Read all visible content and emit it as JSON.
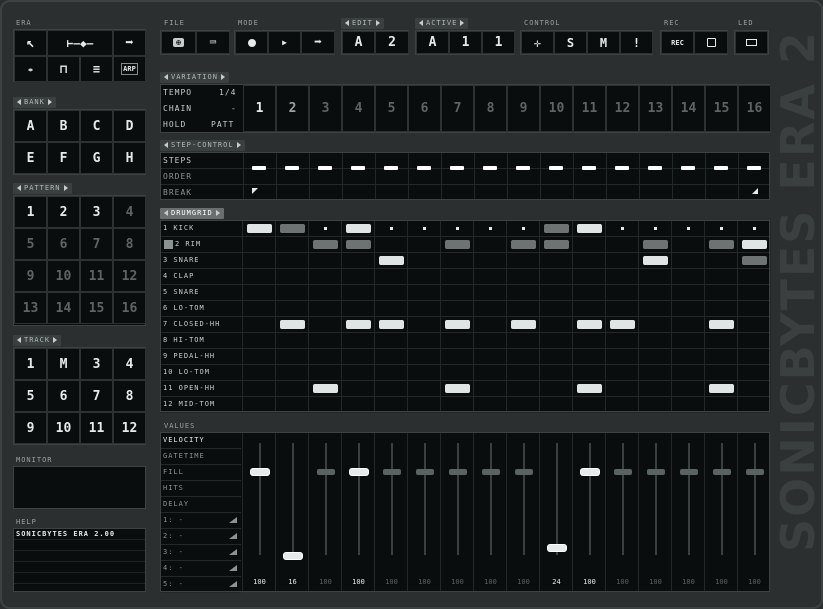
{
  "era": {
    "title": "ERA"
  },
  "bank": {
    "title": "BANK",
    "items": [
      "A",
      "B",
      "C",
      "D",
      "E",
      "F",
      "G",
      "H"
    ]
  },
  "pattern": {
    "title": "PATTERN",
    "items": [
      "1",
      "2",
      "3",
      "4",
      "5",
      "6",
      "7",
      "8",
      "9",
      "10",
      "11",
      "12",
      "13",
      "14",
      "15",
      "16"
    ]
  },
  "track": {
    "title": "TRACK",
    "items": [
      "1",
      "M",
      "3",
      "4",
      "5",
      "6",
      "7",
      "8",
      "9",
      "10",
      "11",
      "12"
    ]
  },
  "monitor": {
    "title": "MONITOR"
  },
  "help": {
    "title": "HELP",
    "text": "SONICBYTES ERA 2.00"
  },
  "file": {
    "title": "FILE"
  },
  "mode": {
    "title": "MODE"
  },
  "edit": {
    "title": "EDIT",
    "a": "A",
    "b": "2"
  },
  "active": {
    "title": "ACTIVE",
    "a": "A",
    "b": "1",
    "c": "1"
  },
  "control": {
    "title": "CONTROL",
    "s": "S",
    "m": "M",
    "x": "!"
  },
  "rec": {
    "title": "REC",
    "rec": "REC"
  },
  "led": {
    "title": "LED"
  },
  "variation": {
    "title": "VARIATION",
    "tempo_label": "TEMPO",
    "tempo_value": "1/4",
    "chain_label": "CHAIN",
    "chain_value": "-",
    "hold_label": "HOLD",
    "hold_value": "PATT",
    "steps": [
      "1",
      "2",
      "3",
      "4",
      "5",
      "6",
      "7",
      "8",
      "9",
      "10",
      "11",
      "12",
      "13",
      "14",
      "15",
      "16"
    ]
  },
  "step_control": {
    "title": "STEP-CONTROL",
    "rows": [
      "STEPS",
      "ORDER",
      "BREAK"
    ]
  },
  "drumgrid": {
    "title": "DRUMGRID",
    "rows": [
      "1 KICK",
      "2 RIM",
      "3 SNARE",
      "4 CLAP",
      "5 SNARE",
      "6 LO-TOM",
      "7 CLOSED-HH",
      "8 HI-TOM",
      "9 PEDAL-HH",
      "10 LO-TOM",
      "11 OPEN-HH",
      "12 MID-TOM"
    ]
  },
  "values": {
    "title": "VALUES",
    "params": [
      "VELOCITY",
      "GATETIME",
      "FILL",
      "HITS",
      "DELAY"
    ],
    "slots": [
      "1: -",
      "2: -",
      "3: -",
      "4: -",
      "5: -"
    ],
    "numbers": [
      "100",
      "16",
      "100",
      "100",
      "100",
      "100",
      "100",
      "100",
      "100",
      "24",
      "100",
      "100",
      "100",
      "100",
      "100",
      "100"
    ],
    "levels": [
      1.0,
      0.16,
      1.0,
      1.0,
      1.0,
      1.0,
      1.0,
      1.0,
      1.0,
      0.24,
      1.0,
      1.0,
      1.0,
      1.0,
      1.0,
      1.0
    ]
  },
  "watermark": "SONICBYTES ERA 2"
}
